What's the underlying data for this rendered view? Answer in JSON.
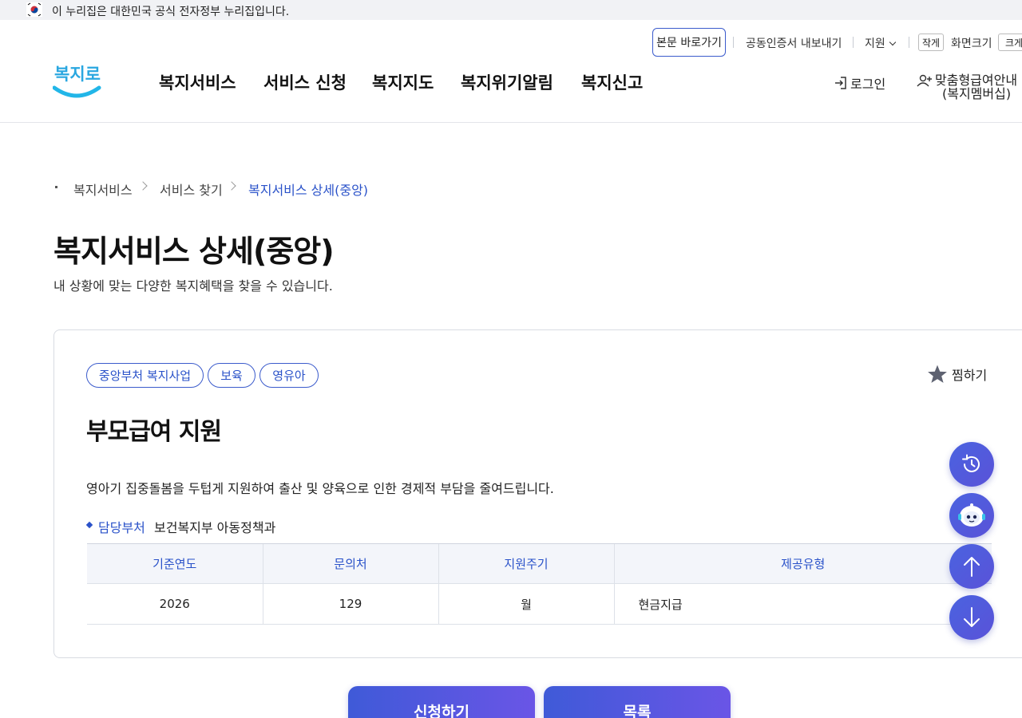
{
  "gov_banner": {
    "text": "이 누리집은 대한민국 공식 전자정부 누리집입니다."
  },
  "util": {
    "skip_label": "본문 바로가기",
    "cert_label": "공동인증서 내보내기",
    "support_label": "지원",
    "zoom_small": "작게",
    "zoom_label": "화면크기",
    "zoom_large": "크게"
  },
  "logo": {
    "text": "복지로"
  },
  "gnb": [
    "복지서비스",
    "서비스 신청",
    "복지지도",
    "복지위기알림",
    "복지신고"
  ],
  "account": {
    "login_label": "로그인",
    "member_line1": "맞춤형급여안내",
    "member_line2": "(복지멤버십)"
  },
  "breadcrumb": [
    "복지서비스",
    "서비스 찾기",
    "복지서비스 상세(중앙)"
  ],
  "page": {
    "title": "복지서비스 상세(중앙)",
    "subtitle": "내 상황에 맞는 다양한 복지혜택을 찾을 수 있습니다."
  },
  "service": {
    "tags": [
      "중앙부처 복지사업",
      "보육",
      "영유아"
    ],
    "fav_label": "찜하기",
    "title": "부모급여 지원",
    "description": "영아기 집중돌봄을 두텁게 지원하여 출산 및 양육으로 인한 경제적 부담을 줄여드립니다.",
    "dept_label": "담당부처",
    "dept_value": "보건복지부 아동정책과",
    "table": {
      "headers": [
        "기준연도",
        "문의처",
        "지원주기",
        "제공유형"
      ],
      "row": [
        "2026",
        "129",
        "월",
        "현금지급"
      ]
    }
  },
  "float_buttons": [
    "recent-history",
    "chatbot",
    "scroll-top",
    "scroll-bottom"
  ],
  "bottom_buttons": {
    "apply_label": "신청하기",
    "list_label": "목록"
  },
  "colors": {
    "accent": "#2a52c9",
    "button_gradient_start": "#3f5ad8",
    "button_gradient_end": "#6a55e6"
  }
}
